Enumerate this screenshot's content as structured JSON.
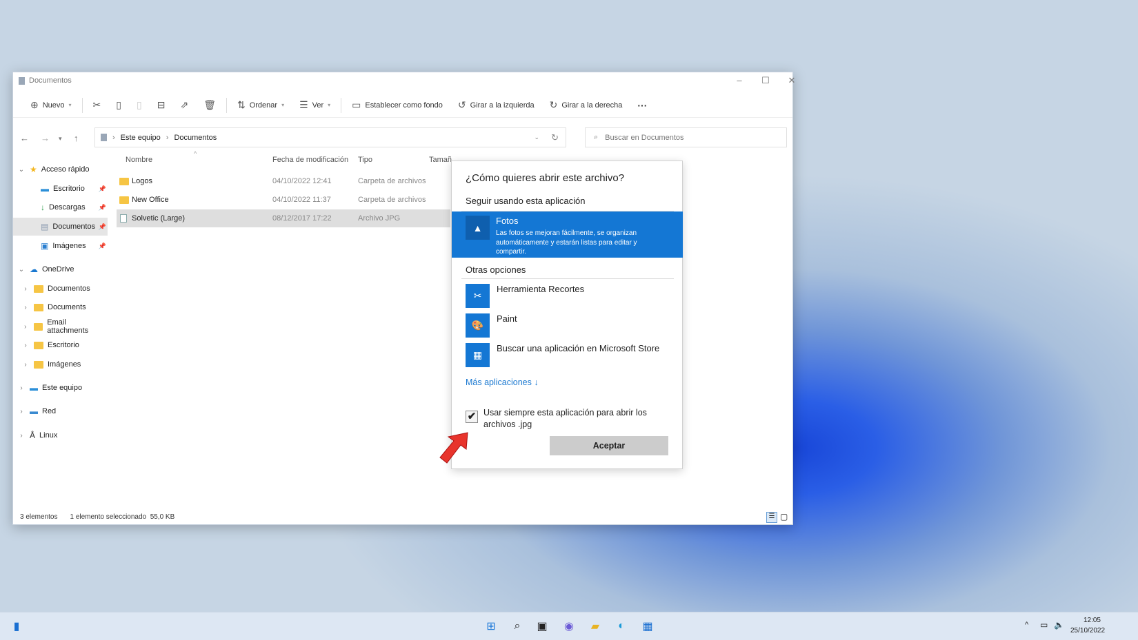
{
  "window": {
    "title": "Documentos",
    "controls": [
      "–",
      "☐",
      "✕"
    ]
  },
  "toolbar": {
    "new": "Nuevo",
    "sort": "Ordenar",
    "view": "Ver",
    "set_background": "Establecer como fondo",
    "rotate_left": "Girar a la izquierda",
    "rotate_right": "Girar a la derecha",
    "more": "···"
  },
  "address": {
    "crumbs": [
      "Este equipo",
      "Documentos"
    ],
    "search_placeholder": "Buscar en Documentos"
  },
  "sidebar": {
    "items": [
      {
        "label": "Acceso rápido",
        "level": 0,
        "expanded": true,
        "icon": "star"
      },
      {
        "label": "Escritorio",
        "level": 1,
        "pinned": true,
        "icon": "desktop"
      },
      {
        "label": "Descargas",
        "level": 1,
        "pinned": true,
        "icon": "download"
      },
      {
        "label": "Documentos",
        "level": 1,
        "pinned": true,
        "selected": true,
        "icon": "document"
      },
      {
        "label": "Imágenes",
        "level": 1,
        "pinned": true,
        "icon": "pictures"
      },
      {
        "label": "OneDrive",
        "level": 0,
        "expanded": true,
        "icon": "cloud"
      },
      {
        "label": "Documentos",
        "level": 1,
        "icon": "folder"
      },
      {
        "label": "Documents",
        "level": 1,
        "icon": "folder"
      },
      {
        "label": "Email attachments",
        "level": 1,
        "icon": "folder"
      },
      {
        "label": "Escritorio",
        "level": 1,
        "icon": "folder"
      },
      {
        "label": "Imágenes",
        "level": 1,
        "icon": "folder"
      },
      {
        "label": "Este equipo",
        "level": 0,
        "icon": "pc"
      },
      {
        "label": "Red",
        "level": 0,
        "icon": "network"
      },
      {
        "label": "Linux",
        "level": 0,
        "icon": "linux"
      }
    ]
  },
  "columns": {
    "name": "Nombre",
    "date": "Fecha de modificación",
    "type": "Tipo",
    "size": "Tamaño"
  },
  "files": [
    {
      "name": "Logos",
      "date": "04/10/2022 12:41",
      "type": "Carpeta de archivos",
      "icon": "folder"
    },
    {
      "name": "New Office",
      "date": "04/10/2022 11:37",
      "type": "Carpeta de archivos",
      "icon": "folder"
    },
    {
      "name": "Solvetic (Large)",
      "date": "08/12/2017 17:22",
      "type": "Archivo JPG",
      "icon": "image",
      "selected": true
    }
  ],
  "status": {
    "count": "3 elementos",
    "selected": "1 elemento seleccionado",
    "size": "55,0 KB"
  },
  "dialog": {
    "title": "¿Cómo quieres abrir este archivo?",
    "keep_using": "Seguir usando esta aplicación",
    "current_app": {
      "name": "Fotos",
      "description": "Las fotos se mejoran fácilmente, se organizan automáticamente y estarán listas para editar y compartir."
    },
    "other_options": "Otras opciones",
    "apps": [
      "Herramienta Recortes",
      "Paint",
      "Buscar una aplicación en Microsoft Store"
    ],
    "more_apps": "Más aplicaciones ↓",
    "always_use": "Usar siempre esta aplicación para abrir los archivos .jpg",
    "always_use_checked": true,
    "ok": "Aceptar",
    "accent": "#1477d4"
  },
  "taskbar": {
    "time": "12:05",
    "date": "25/10/2022"
  }
}
